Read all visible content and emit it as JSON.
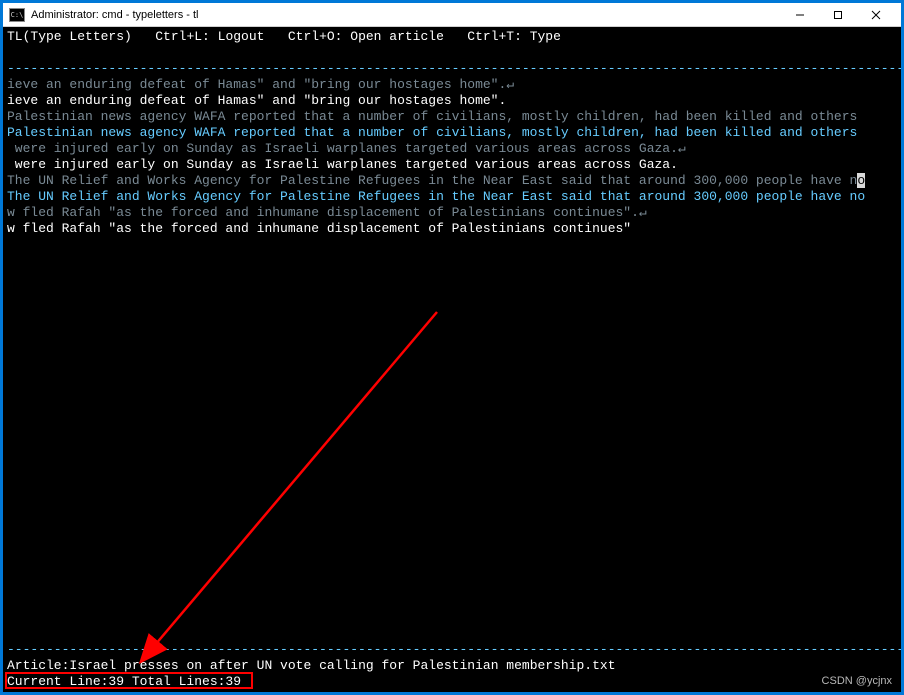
{
  "titlebar": {
    "icon_text": "C:\\",
    "title": "Administrator: cmd - typeletters - tl"
  },
  "menu": {
    "app_name": "TL(Type Letters)",
    "shortcut1": "Ctrl+L: Logout",
    "shortcut2": "Ctrl+O: Open article",
    "shortcut3": "Ctrl+T: Type"
  },
  "divider": "------------------------------------------------------------------------------------------------------------------------------------------------",
  "lines": {
    "l1_dim": "ieve an enduring defeat of Hamas\" and \"bring our hostages home\".↵",
    "l1_white": "ieve an enduring defeat of Hamas\" and \"bring our hostages home\".",
    "l2_dim": "Palestinian news agency WAFA reported that a number of civilians, mostly children, had been killed and others",
    "l2_cyan": "Palestinian news agency WAFA reported that a number of civilians, mostly children, had been killed and others",
    "l3_dim": " were injured early on Sunday as Israeli warplanes targeted various areas across Gaza.↵",
    "l3_white": " were injured early on Sunday as Israeli warplanes targeted various areas across Gaza.",
    "l4_dim_a": "The UN Relief and Works Agency for Palestine Refugees in the Near East said that around 300,000 people have n",
    "l4_cursor": "o",
    "l4_cyan": "The UN Relief and Works Agency for Palestine Refugees in the Near East said that around 300,000 people have no",
    "l5_dim": "w fled Rafah \"as the forced and inhumane displacement of Palestinians continues\".↵",
    "l5_white": "w fled Rafah \"as the forced and inhumane displacement of Palestinians continues\""
  },
  "status": {
    "article_label": "Article:",
    "article_name": "Israel presses on after UN vote calling for Palestinian membership.txt",
    "line_info": "Current Line:39 Total Lines:39"
  },
  "watermark": "CSDN @ycjnx"
}
